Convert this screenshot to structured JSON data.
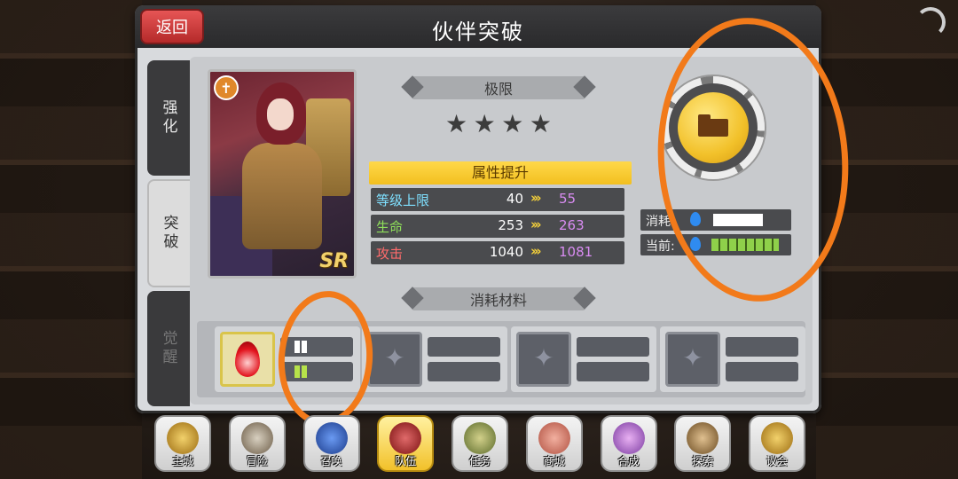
{
  "header": {
    "back_label": "返回",
    "title": "伙伴突破"
  },
  "side_tabs": [
    {
      "label": "强化",
      "active": false
    },
    {
      "label": "突破",
      "active": true
    },
    {
      "label": "觉醒",
      "active": false
    }
  ],
  "card": {
    "rarity": "SR",
    "badge": "✝",
    "stars": 4
  },
  "limit": {
    "label": "极限",
    "stars": [
      "★",
      "★",
      "★",
      "★"
    ]
  },
  "attributes": {
    "header": "属性提升",
    "arrow": "›››",
    "rows": [
      {
        "name": "等级上限",
        "current": "40",
        "new": "55",
        "color": "#7fe0ff"
      },
      {
        "name": "生命",
        "current": "253",
        "new": "263",
        "color": "#8fe05a"
      },
      {
        "name": "攻击",
        "current": "1040",
        "new": "1081",
        "color": "#ff6b6b"
      }
    ]
  },
  "cost": {
    "consume_label": "消耗",
    "current_label": "当前:"
  },
  "materials": {
    "label": "消耗材料",
    "slots": 4
  },
  "nav": [
    {
      "label": "主城",
      "color": "#c9962a"
    },
    {
      "label": "冒险",
      "color": "#7a6a55"
    },
    {
      "label": "召唤",
      "color": "#2a4fa8"
    },
    {
      "label": "队伍",
      "color": "#c02a2a",
      "active": true
    },
    {
      "label": "任务",
      "color": "#7b8a3a"
    },
    {
      "label": "商城",
      "color": "#d06a6a"
    },
    {
      "label": "合成",
      "color": "#a060c0"
    },
    {
      "label": "探索",
      "color": "#8a6a40"
    },
    {
      "label": "议会",
      "color": "#c9962a"
    }
  ]
}
